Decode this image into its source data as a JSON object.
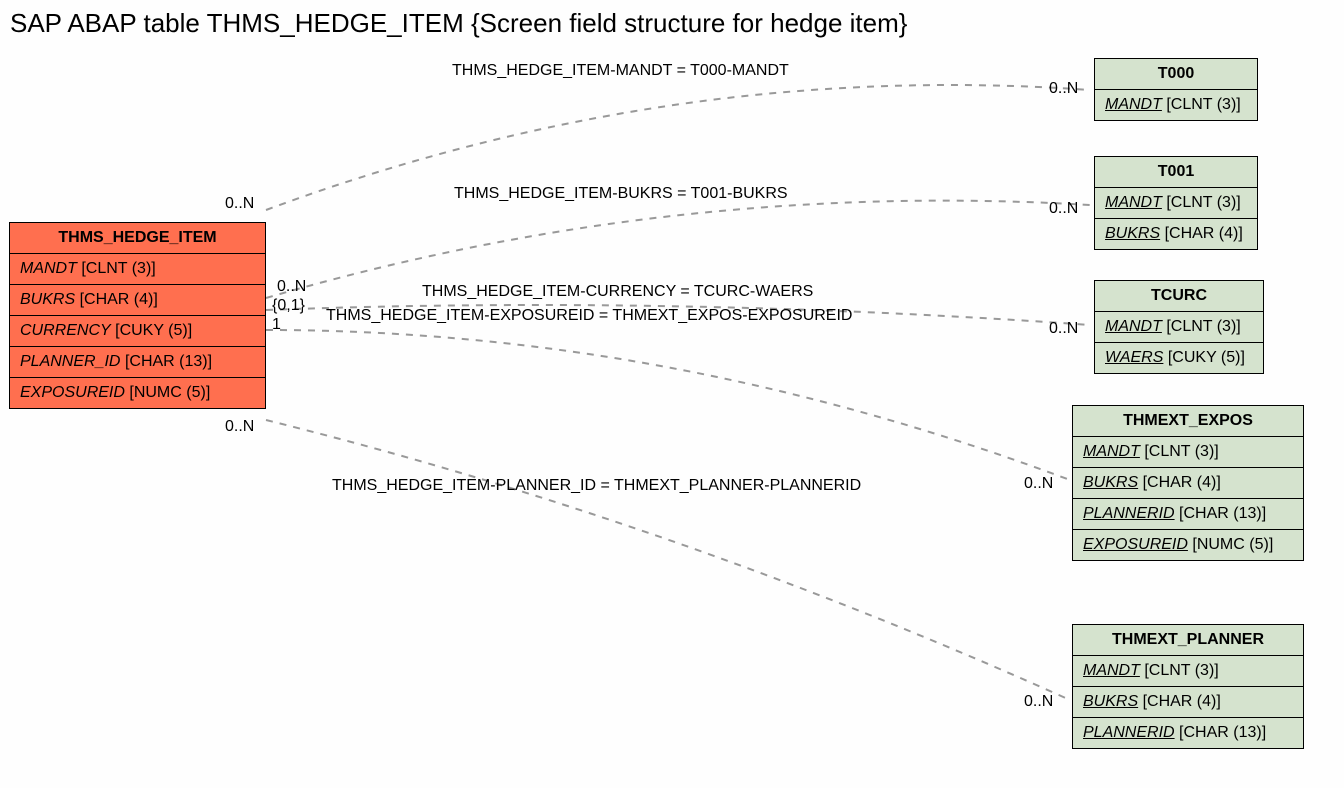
{
  "title": "SAP ABAP table THMS_HEDGE_ITEM {Screen field structure for hedge item}",
  "mainEntity": {
    "name": "THMS_HEDGE_ITEM",
    "fields": [
      {
        "name": "MANDT",
        "type": "[CLNT (3)]"
      },
      {
        "name": "BUKRS",
        "type": "[CHAR (4)]"
      },
      {
        "name": "CURRENCY",
        "type": "[CUKY (5)]"
      },
      {
        "name": "PLANNER_ID",
        "type": "[CHAR (13)]"
      },
      {
        "name": "EXPOSUREID",
        "type": "[NUMC (5)]"
      }
    ]
  },
  "relations": [
    {
      "label": "THMS_HEDGE_ITEM-MANDT = T000-MANDT"
    },
    {
      "label": "THMS_HEDGE_ITEM-BUKRS = T001-BUKRS"
    },
    {
      "label": "THMS_HEDGE_ITEM-CURRENCY = TCURC-WAERS"
    },
    {
      "label": "THMS_HEDGE_ITEM-EXPOSUREID = THMEXT_EXPOS-EXPOSUREID"
    },
    {
      "label": "THMS_HEDGE_ITEM-PLANNER_ID = THMEXT_PLANNER-PLANNERID"
    }
  ],
  "cardinalities": {
    "leftTop": "0..N",
    "leftMid1": "0..N",
    "leftMid2": "{0,1}",
    "leftMid3": "1",
    "leftBottom": "0..N",
    "r0": "0..N",
    "r1": "0..N",
    "r2": "0..N",
    "r3": "0..N",
    "r4": "0..N"
  },
  "targetEntities": [
    {
      "name": "T000",
      "fields": [
        {
          "name": "MANDT",
          "type": "[CLNT (3)]",
          "underline": true
        }
      ]
    },
    {
      "name": "T001",
      "fields": [
        {
          "name": "MANDT",
          "type": "[CLNT (3)]",
          "underline": true
        },
        {
          "name": "BUKRS",
          "type": "[CHAR (4)]",
          "underline": true
        }
      ]
    },
    {
      "name": "TCURC",
      "fields": [
        {
          "name": "MANDT",
          "type": "[CLNT (3)]",
          "underline": true
        },
        {
          "name": "WAERS",
          "type": "[CUKY (5)]",
          "underline": true
        }
      ]
    },
    {
      "name": "THMEXT_EXPOS",
      "fields": [
        {
          "name": "MANDT",
          "type": "[CLNT (3)]",
          "underline": true
        },
        {
          "name": "BUKRS",
          "type": "[CHAR (4)]",
          "underline": true
        },
        {
          "name": "PLANNERID",
          "type": "[CHAR (13)]",
          "underline": true
        },
        {
          "name": "EXPOSUREID",
          "type": "[NUMC (5)]",
          "underline": true
        }
      ]
    },
    {
      "name": "THMEXT_PLANNER",
      "fields": [
        {
          "name": "MANDT",
          "type": "[CLNT (3)]",
          "underline": true
        },
        {
          "name": "BUKRS",
          "type": "[CHAR (4)]",
          "underline": true
        },
        {
          "name": "PLANNERID",
          "type": "[CHAR (13)]",
          "underline": true
        }
      ]
    }
  ]
}
